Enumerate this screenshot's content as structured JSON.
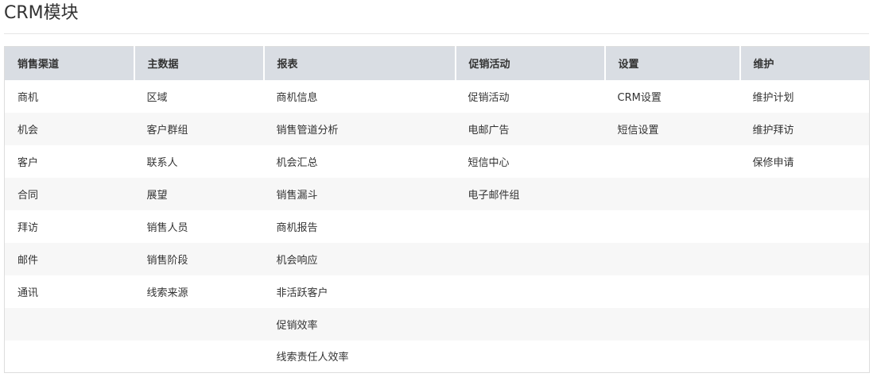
{
  "page": {
    "title": "CRM模块"
  },
  "table": {
    "headers": [
      "销售渠道",
      "主数据",
      "报表",
      "促销活动",
      "设置",
      "维护"
    ],
    "columns": [
      [
        "商机",
        "机会",
        "客户",
        "合同",
        "拜访",
        "邮件",
        "通讯"
      ],
      [
        "区域",
        "客户群组",
        "联系人",
        "展望",
        "销售人员",
        "销售阶段",
        "线索来源"
      ],
      [
        "商机信息",
        "销售管道分析",
        "机会汇总",
        "销售漏斗",
        "商机报告",
        "机会响应",
        "非活跃客户",
        "促销效率",
        "线索责任人效率"
      ],
      [
        "促销活动",
        "电邮广告",
        "短信中心",
        "电子邮件组"
      ],
      [
        "CRM设置",
        "短信设置"
      ],
      [
        "维护计划",
        "维护拜访",
        "保修申请"
      ]
    ]
  }
}
